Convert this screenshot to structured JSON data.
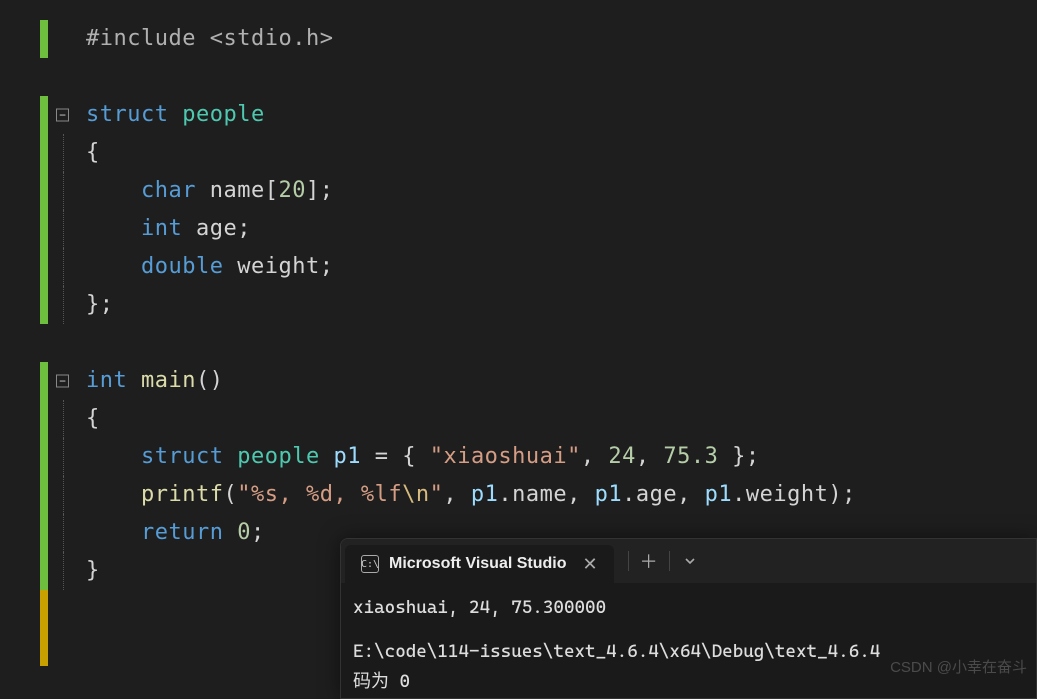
{
  "code": {
    "l1": {
      "pre": "#include ",
      "open": "<",
      "hdr": "stdio.h",
      "close": ">"
    },
    "l3": {
      "kw": "struct",
      "sp": " ",
      "ty": "people"
    },
    "l4": {
      "br": "{"
    },
    "l5": {
      "kw": "char",
      "sp": " ",
      "id": "name",
      "br1": "[",
      "num": "20",
      "br2": "]",
      ";": ";"
    },
    "l6": {
      "kw": "int",
      "sp": " ",
      "id": "age",
      ";": ";"
    },
    "l7": {
      "kw": "double",
      "sp": " ",
      "id": "weight",
      ";": ";"
    },
    "l8": {
      "br": "}",
      ";": ";"
    },
    "l10": {
      "kw": "int",
      "sp": " ",
      "fn": "main",
      "p": "()"
    },
    "l11": {
      "br": "{"
    },
    "l12": {
      "kw": "struct",
      "sp1": " ",
      "ty": "people",
      "sp2": " ",
      "var": "p1",
      "sp3": " ",
      "eq": "=",
      "sp4": " ",
      "ob": "{ ",
      "s": "\"xiaoshuai\"",
      "c1": ", ",
      "n1": "24",
      "c2": ", ",
      "n2": "75.3",
      "cb": " }",
      ";": ";"
    },
    "l13": {
      "fn": "printf",
      "op": "(",
      "s1": "\"%s, %d, %lf",
      "esc": "\\n",
      "s2": "\"",
      "c1": ", ",
      "v1": "p1",
      "d1": ".",
      "m1": "name",
      "c2": ", ",
      "v2": "p1",
      "d2": ".",
      "m2": "age",
      "c3": ", ",
      "v3": "p1",
      "d3": ".",
      "m3": "weight",
      "cp": ")",
      ";": ";"
    },
    "l14": {
      "kw": "return",
      "sp": " ",
      "n": "0",
      ";": ";"
    },
    "l15": {
      "br": "}"
    }
  },
  "fold_glyph": "−",
  "terminal": {
    "tab_title": "Microsoft Visual Studio",
    "cmd_icon_text": "C:\\",
    "output_line1": "xiaoshuai, 24, 75.300000",
    "output_line2": "E:\\code\\114-issues\\text_4.6.4\\x64\\Debug\\text_4.6.4",
    "output_line3_partial": "码为 0"
  },
  "watermark": "CSDN @小幸在奋斗"
}
